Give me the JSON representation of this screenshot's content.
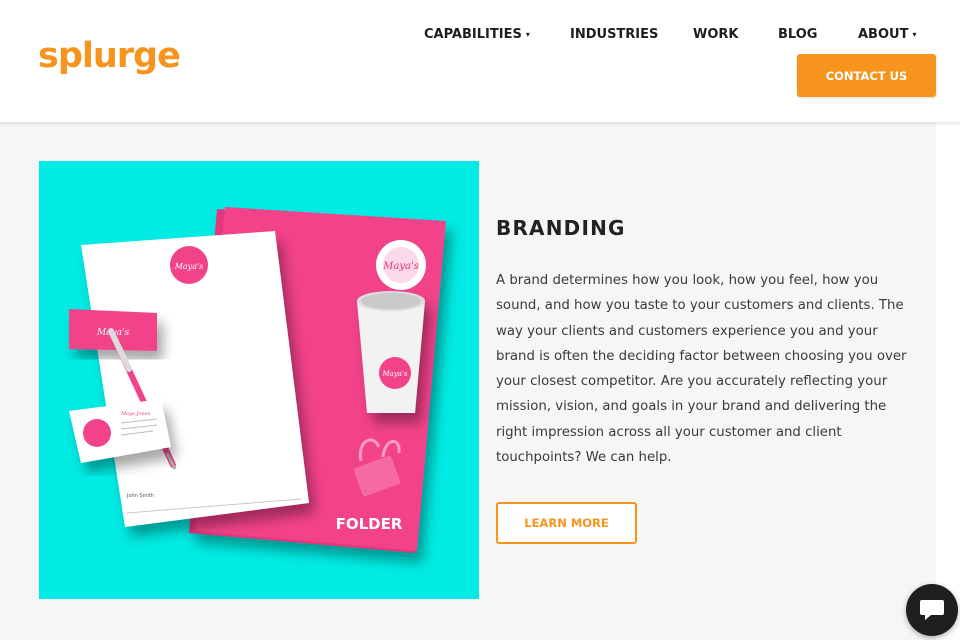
{
  "header": {
    "logo": "splurge",
    "nav": [
      {
        "label": "CAPABILITIES",
        "caret": "▾"
      },
      {
        "label": "INDUSTRIES"
      },
      {
        "label": "WORK"
      },
      {
        "label": "BLOG"
      },
      {
        "label": "ABOUT",
        "caret": "▾"
      }
    ],
    "contact_label": "CONTACT US"
  },
  "section": {
    "title": "BRANDING",
    "body": "A brand determines how you look, how you feel, how you sound, and how you taste to your customers and clients. The way your clients and customers experience you and your brand is often the deciding factor between choosing you over your closest competitor. Are you accurately reflecting your mission, vision, and goals in your brand and delivering the right impression across all your customer and client touchpoints? We can help.",
    "button_label": "LEARN MORE"
  },
  "illustration": {
    "folder_label": "FOLDER",
    "brand_mark": "Maya's",
    "card_name": "Maya Jones",
    "letter_name": "John Smith"
  },
  "chat": {
    "icon": "chat-bubble-icon"
  },
  "colors": {
    "brand": "#f7941d",
    "hero_bg": "#00ebe3",
    "pink": "#f0397f",
    "text": "#3a3a3a"
  }
}
